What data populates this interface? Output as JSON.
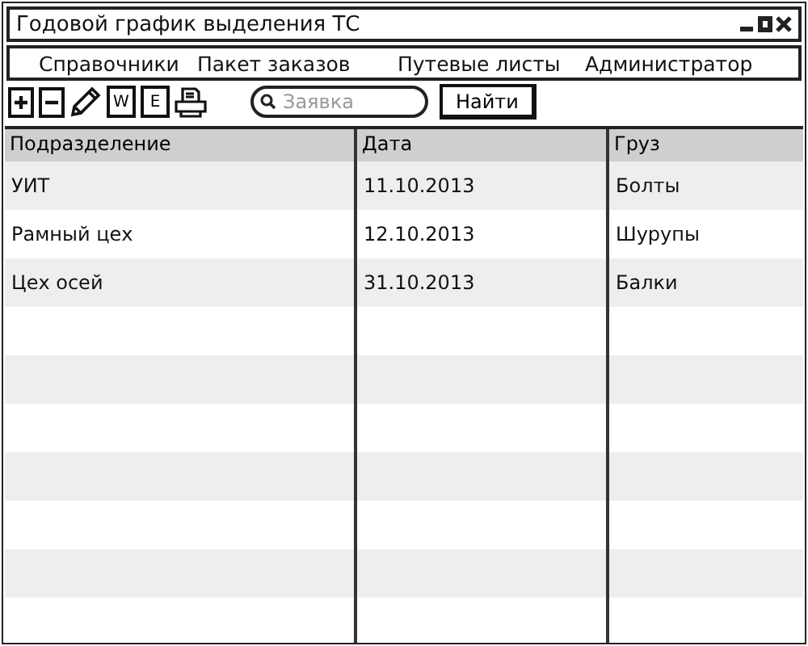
{
  "window": {
    "title": "Годовой график выделения ТС"
  },
  "menu": [
    "Справочники",
    "Пакет заказов",
    "Путевые листы",
    "Администратор"
  ],
  "toolbar": [
    {
      "kind": "plus"
    },
    {
      "kind": "minus"
    },
    {
      "kind": "pencil"
    },
    {
      "kind": "doc",
      "label": "W"
    },
    {
      "kind": "doc",
      "label": "E"
    },
    {
      "kind": "printer"
    }
  ],
  "search": {
    "placeholder": "Заявка",
    "button": "Найти"
  },
  "table": {
    "columns": [
      "Подразделение",
      "Дата",
      "Груз"
    ],
    "rows": [
      [
        "УИТ",
        "11.10.2013",
        "Болты"
      ],
      [
        "Рамный цех",
        "12.10.2013",
        "Шурупы"
      ],
      [
        "Цех осей",
        "31.10.2013",
        "Балки"
      ]
    ]
  }
}
